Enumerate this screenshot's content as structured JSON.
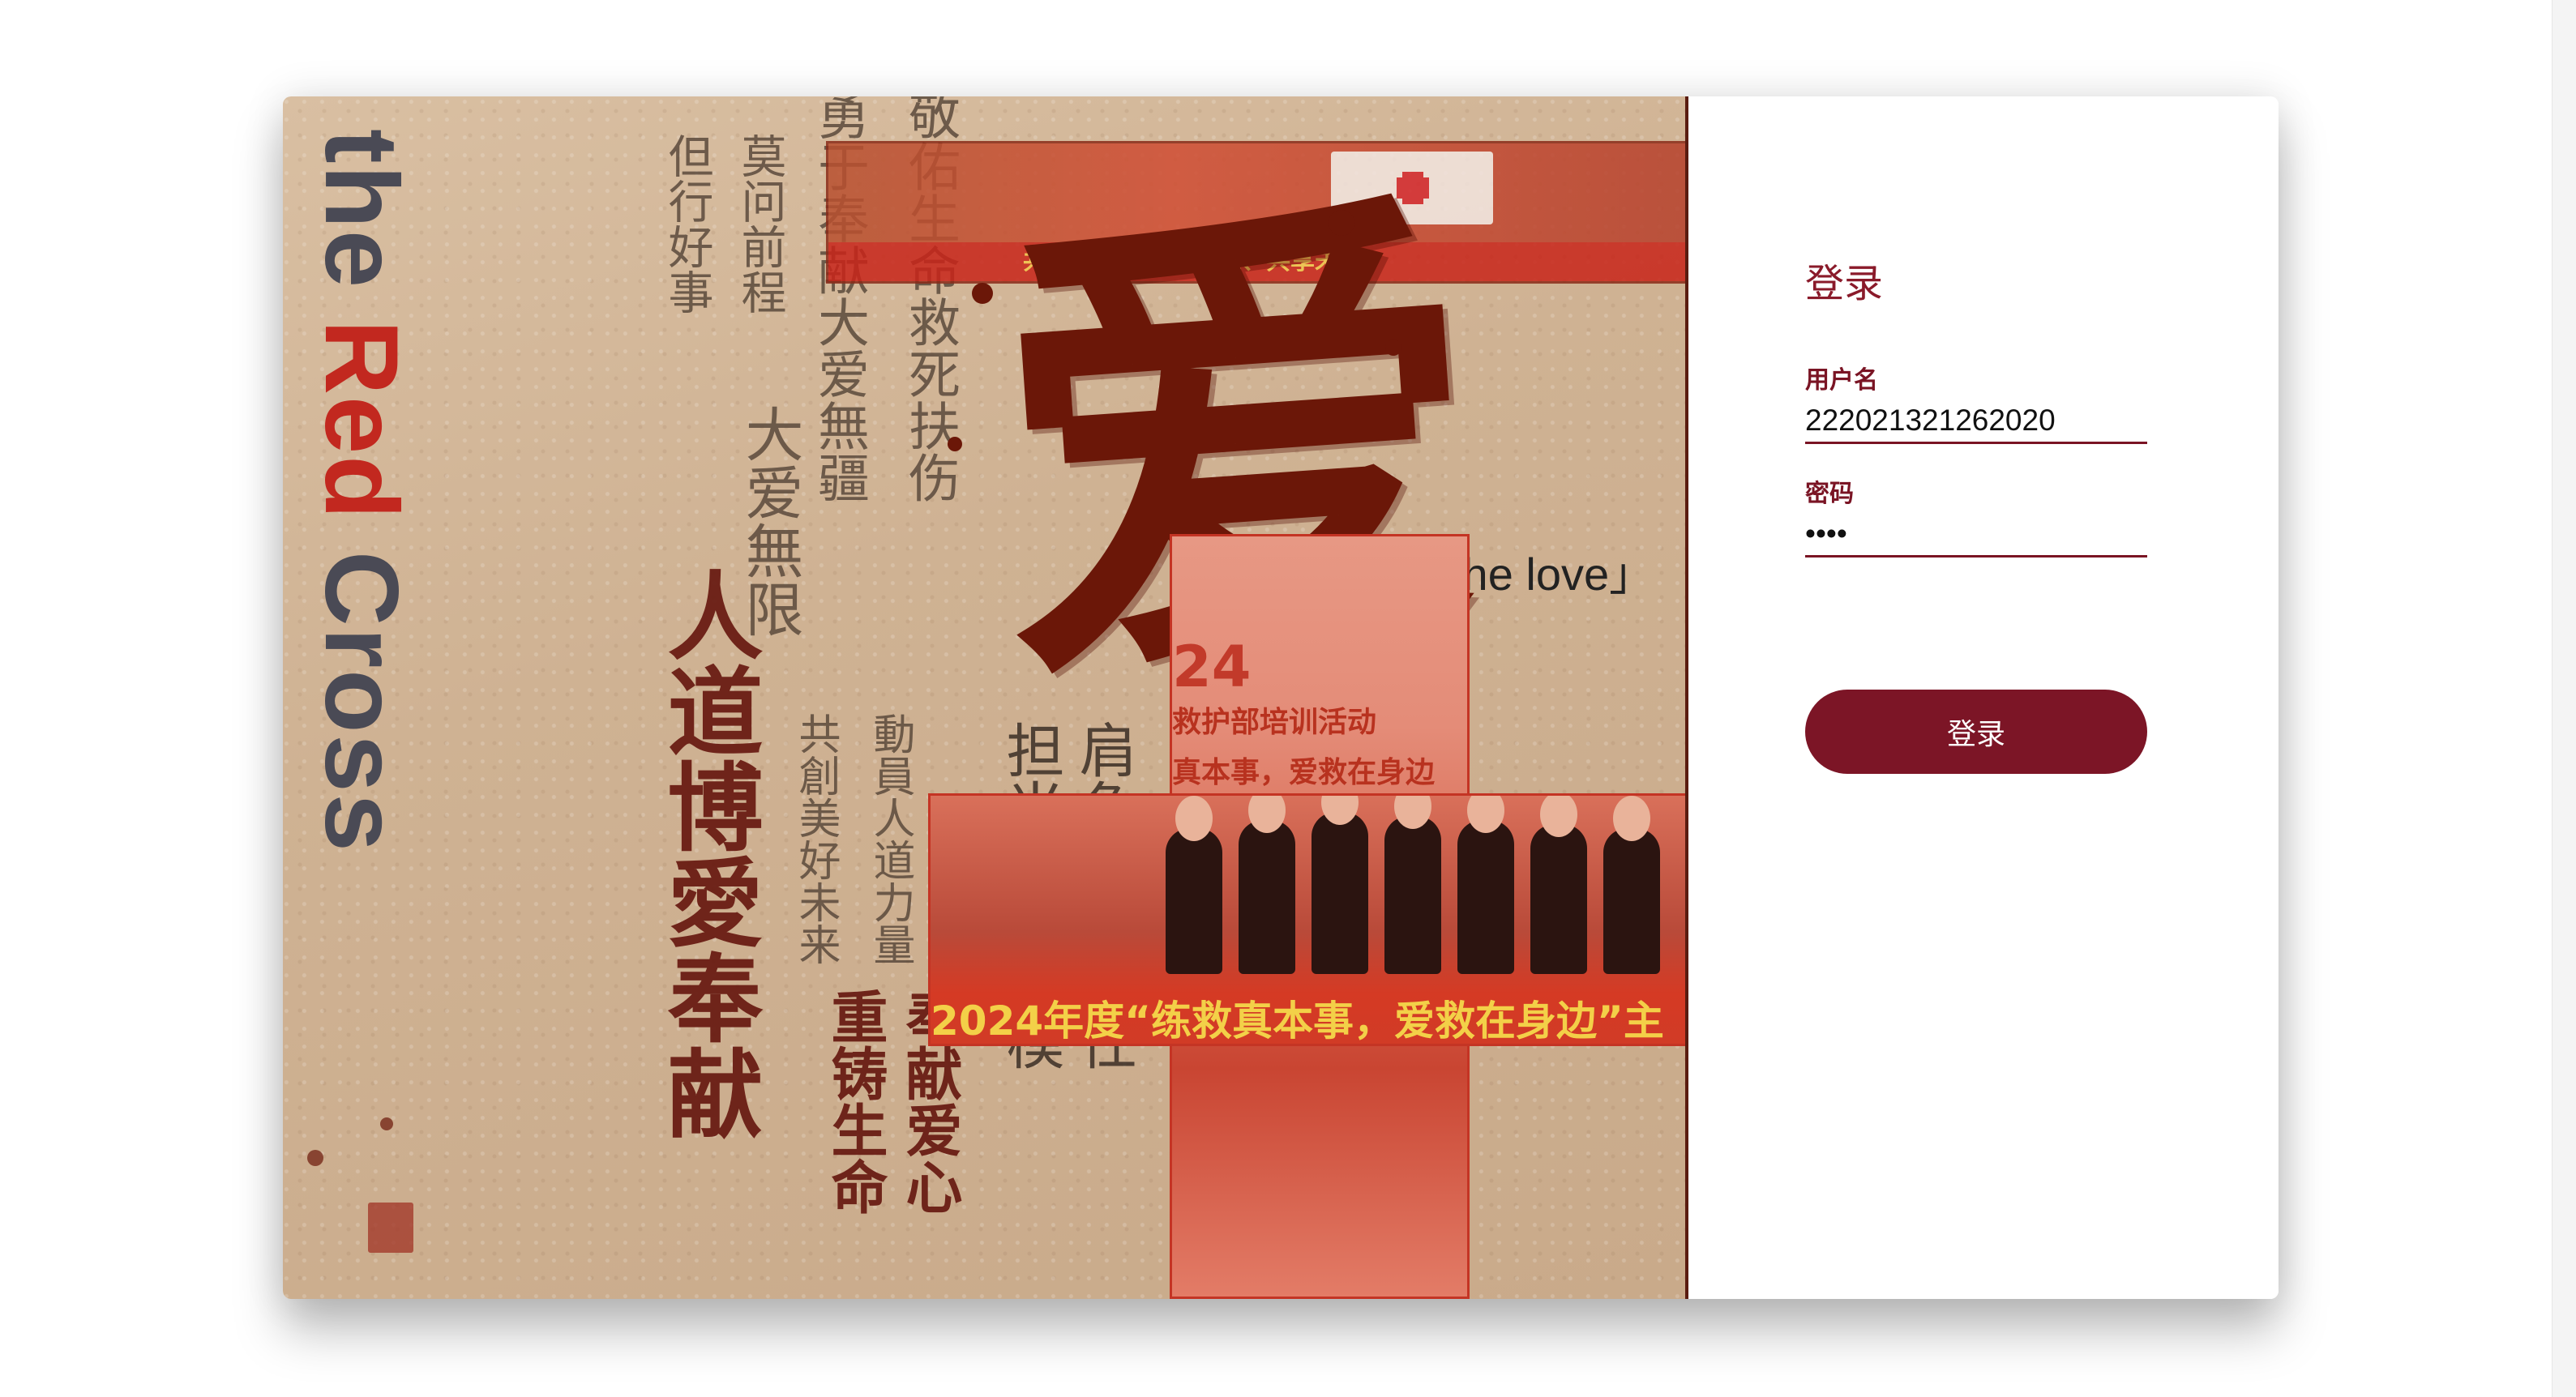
{
  "poster": {
    "vertical_title_the": "the ",
    "vertical_title_red": "Red",
    "vertical_title_cross": " Cross",
    "big_character": "爱",
    "the_love": "「the love」",
    "calligraphy": {
      "col1": "敬佑生命救死扶伤",
      "col2": "勇于奉献大爱無疆",
      "col3": "莫问前程",
      "col4": "但行好事",
      "col5": "大爱無限",
      "col6": "人道博愛奉献",
      "col7": "共創美好未来",
      "col8": "動員人道力量",
      "col9": "重铸生命",
      "col10": "奉献爱心",
      "col11": "担当公益楷模",
      "col12": "肩负社会责任"
    },
    "top_banner_text": "共抗结核、共担责任、共享未来",
    "cross_year": "24",
    "cross_caption": "救护部培训活动",
    "cross_slogan_top": "真本事，爱救在身边",
    "cross_slogan_bottom": "2024年度“练救真本事，爱救在身边”主"
  },
  "login": {
    "title": "登录",
    "username_label": "用户名",
    "username_value": "222021321262020",
    "password_label": "密码",
    "password_value": "••••",
    "button_label": "登录"
  },
  "colors": {
    "accent": "#7c1526",
    "label": "#7a1424",
    "title": "#8a1a2a"
  }
}
